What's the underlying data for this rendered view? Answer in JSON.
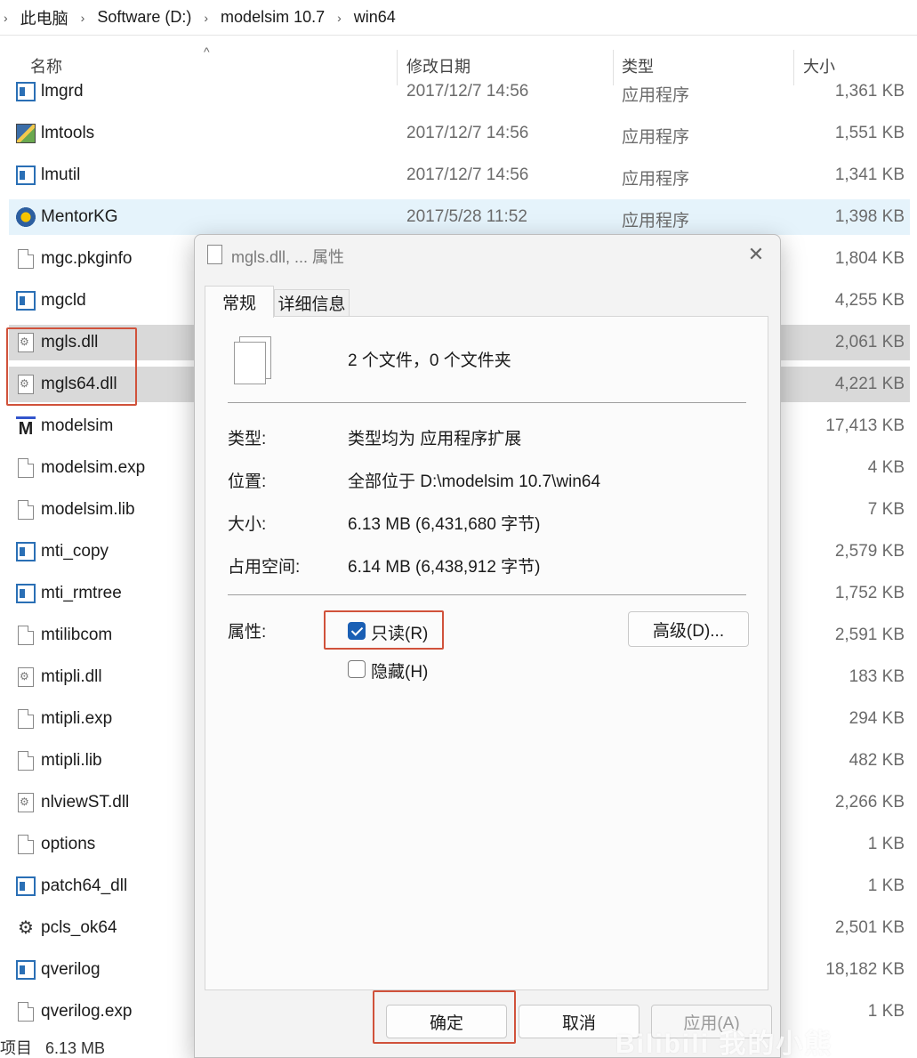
{
  "breadcrumb": {
    "items": [
      "此电脑",
      "Software (D:)",
      "modelsim 10.7",
      "win64"
    ]
  },
  "columns": {
    "name": "名称",
    "date": "修改日期",
    "type": "类型",
    "size": "大小"
  },
  "files": [
    {
      "name": "lmgrd",
      "date": "2017/12/7 14:56",
      "type": "应用程序",
      "size": "1,361 KB",
      "icon": "exe"
    },
    {
      "name": "lmtools",
      "date": "2017/12/7 14:56",
      "type": "应用程序",
      "size": "1,551 KB",
      "icon": "tools"
    },
    {
      "name": "lmutil",
      "date": "2017/12/7 14:56",
      "type": "应用程序",
      "size": "1,341 KB",
      "icon": "exe"
    },
    {
      "name": "MentorKG",
      "date": "2017/5/28 11:52",
      "type": "应用程序",
      "size": "1,398 KB",
      "icon": "mentor"
    },
    {
      "name": "mgc.pkginfo",
      "date": "",
      "type": "",
      "size": "1,804 KB",
      "icon": "file"
    },
    {
      "name": "mgcld",
      "date": "",
      "type": "",
      "size": "4,255 KB",
      "icon": "exe"
    },
    {
      "name": "mgls.dll",
      "date": "",
      "type": "",
      "size": "2,061 KB",
      "icon": "dll"
    },
    {
      "name": "mgls64.dll",
      "date": "",
      "type": "",
      "size": "4,221 KB",
      "icon": "dll"
    },
    {
      "name": "modelsim",
      "date": "",
      "type": "",
      "size": "17,413 KB",
      "icon": "m"
    },
    {
      "name": "modelsim.exp",
      "date": "",
      "type": "",
      "size": "4 KB",
      "icon": "file"
    },
    {
      "name": "modelsim.lib",
      "date": "",
      "type": "",
      "size": "7 KB",
      "icon": "file"
    },
    {
      "name": "mti_copy",
      "date": "",
      "type": "",
      "size": "2,579 KB",
      "icon": "exe"
    },
    {
      "name": "mti_rmtree",
      "date": "",
      "type": "",
      "size": "1,752 KB",
      "icon": "exe"
    },
    {
      "name": "mtilibcom",
      "date": "",
      "type": "",
      "size": "2,591 KB",
      "icon": "file"
    },
    {
      "name": "mtipli.dll",
      "date": "",
      "type": "",
      "size": "183 KB",
      "icon": "dll"
    },
    {
      "name": "mtipli.exp",
      "date": "",
      "type": "",
      "size": "294 KB",
      "icon": "file"
    },
    {
      "name": "mtipli.lib",
      "date": "",
      "type": "",
      "size": "482 KB",
      "icon": "file"
    },
    {
      "name": "nlviewST.dll",
      "date": "",
      "type": "",
      "size": "2,266 KB",
      "icon": "dll"
    },
    {
      "name": "options",
      "date": "",
      "type": "",
      "size": "1 KB",
      "icon": "file"
    },
    {
      "name": "patch64_dll",
      "date": "",
      "type": "",
      "size": "1 KB",
      "icon": "exe"
    },
    {
      "name": "pcls_ok64",
      "date": "",
      "type": "",
      "size": "2,501 KB",
      "icon": "gear"
    },
    {
      "name": "qverilog",
      "date": "",
      "type": "",
      "size": "18,182 KB",
      "icon": "exe"
    },
    {
      "name": "qverilog.exp",
      "date": "",
      "type": "",
      "size": "1 KB",
      "icon": "file"
    }
  ],
  "statusbar": {
    "items_text": "项目",
    "selected_size": "6.13 MB"
  },
  "dialog": {
    "title": "mgls.dll, ... 属性",
    "tabs": {
      "general": "常规",
      "details": "详细信息"
    },
    "summary": "2 个文件，0 个文件夹",
    "props": {
      "type_label": "类型:",
      "type_value": "类型均为 应用程序扩展",
      "location_label": "位置:",
      "location_value": "全部位于 D:\\modelsim 10.7\\win64",
      "size_label": "大小:",
      "size_value": "6.13 MB (6,431,680 字节)",
      "disk_label": "占用空间:",
      "disk_value": "6.14 MB (6,438,912 字节)"
    },
    "attributes": {
      "label": "属性:",
      "readonly": "只读(R)",
      "hidden": "隐藏(H)",
      "advanced": "高级(D)..."
    },
    "buttons": {
      "ok": "确定",
      "cancel": "取消",
      "apply": "应用(A)"
    }
  },
  "watermark": "Bilibili 我的小熊"
}
